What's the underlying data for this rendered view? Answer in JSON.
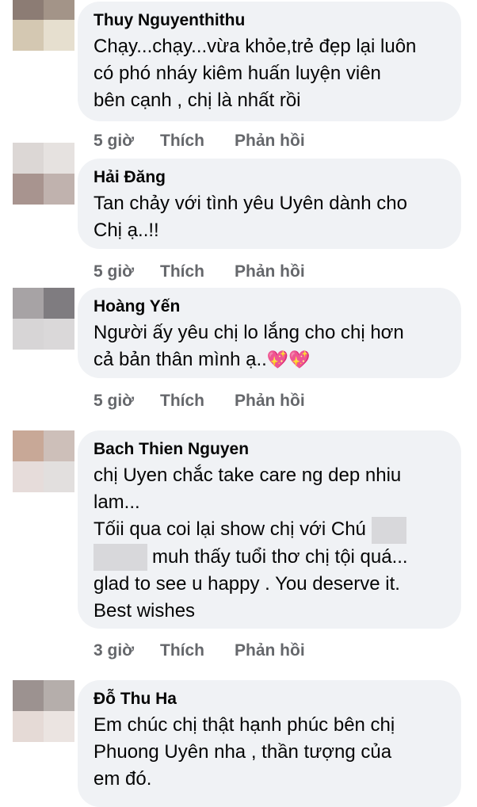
{
  "actions": {
    "like": "Thích",
    "reply": "Phản hồi"
  },
  "comments": [
    {
      "author": "Thuy Nguyenthithu",
      "time": "5 giờ",
      "lines": [
        "Chạy...chạy...vừa khỏe,trẻ đẹp lại luôn",
        "có phó nháy kiêm huấn luyện viên",
        "bên cạnh , chị là nhất rồi"
      ],
      "avatar": [
        "#8c7c74",
        "#a39488",
        "#d4c8b2",
        "#e6dfcf"
      ]
    },
    {
      "author": "Hải Đăng",
      "time": "5 giờ",
      "lines": [
        "Tan chảy với tình yêu Uyên dành cho",
        "Chị ạ..!!"
      ],
      "avatar": [
        "#dcd7d5",
        "#e6e2e0",
        "#a8948f",
        "#c0b2ae"
      ]
    },
    {
      "author": "Hoàng Yến",
      "time": "5 giờ",
      "lines": [
        "Người ấy yêu chị lo lắng cho chị hơn",
        "cả bản thân mình ạ.."
      ],
      "emoji": "💖💖",
      "avatar": [
        "#a7a3a5",
        "#7f7c80",
        "#d7d5d6",
        "#dad8d9"
      ]
    },
    {
      "author": "Bach Thien Nguyen",
      "time": "3 giờ",
      "lines": [
        "chị Uyen chắc take care ng dep nhiu",
        "lam...",
        "Tốii qua coi lại show chị với Chú",
        "muh thấy tuổi thơ chị tội quá...",
        "glad to see u happy . You deserve it.",
        "Best wishes"
      ],
      "avatar": [
        "#c8a897",
        "#cdbfb9",
        "#e6dcda",
        "#e2dfde"
      ]
    },
    {
      "author": "Đỗ Thu Ha",
      "time": "",
      "lines": [
        "Em chúc chị thật hạnh phúc bên chị",
        "Phuong Uyên nha , thần tượng của",
        "em đó."
      ],
      "avatar": [
        "#9c9290",
        "#b5aeab",
        "#e5dad6",
        "#ebe4e1"
      ]
    }
  ]
}
